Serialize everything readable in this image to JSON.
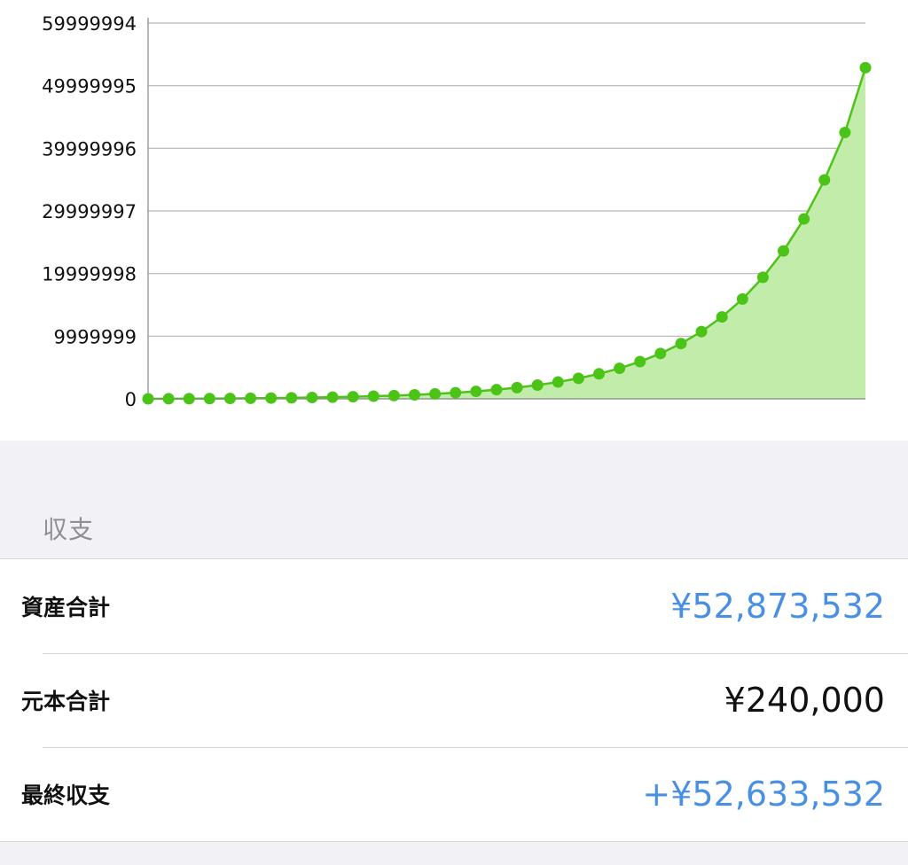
{
  "chart_data": {
    "type": "area",
    "x": [
      1,
      2,
      3,
      4,
      5,
      6,
      7,
      8,
      9,
      10,
      11,
      12,
      13,
      14,
      15,
      16,
      17,
      18,
      19,
      20,
      21,
      22,
      23,
      24,
      25,
      26,
      27,
      28,
      29,
      30,
      31,
      32,
      33,
      34,
      35,
      36,
      37,
      38,
      39,
      40
    ],
    "series": [
      {
        "values": [
          0,
          10000,
          20000,
          40000,
          60000,
          90000,
          120000,
          160000,
          210000,
          270000,
          340000,
          420000,
          520000,
          640000,
          790000,
          970000,
          1190000,
          1460000,
          1790000,
          2190000,
          2680000,
          3270000,
          3990000,
          4870000,
          5940000,
          7240000,
          8820000,
          10740000,
          13080000,
          15930000,
          19400000,
          23610000,
          28720000,
          34950000,
          42530000,
          52873532
        ],
        "x_start": 1
      }
    ],
    "yticks": [
      "59999994",
      "49999995",
      "39999996",
      "29999997",
      "19999998",
      "9999999",
      "0"
    ],
    "ytick_values": [
      59999994,
      49999995,
      39999996,
      29999997,
      19999998,
      9999999,
      0
    ],
    "ylim": [
      0,
      59999994
    ],
    "grid": true,
    "colors": {
      "line": "#4cc417",
      "fill": "#c1eca9",
      "grid": "#b4b4b4",
      "axis": "#888888"
    }
  },
  "section": {
    "title": "収支"
  },
  "rows": [
    {
      "label": "資産合計",
      "value": "¥52,873,532",
      "color": "blue"
    },
    {
      "label": "元本合計",
      "value": "¥240,000",
      "color": "black"
    },
    {
      "label": "最終収支",
      "value": "+¥52,633,532",
      "color": "blue"
    }
  ],
  "colors": {
    "accent": "#4a90e2",
    "background": "#f1f1f6"
  }
}
